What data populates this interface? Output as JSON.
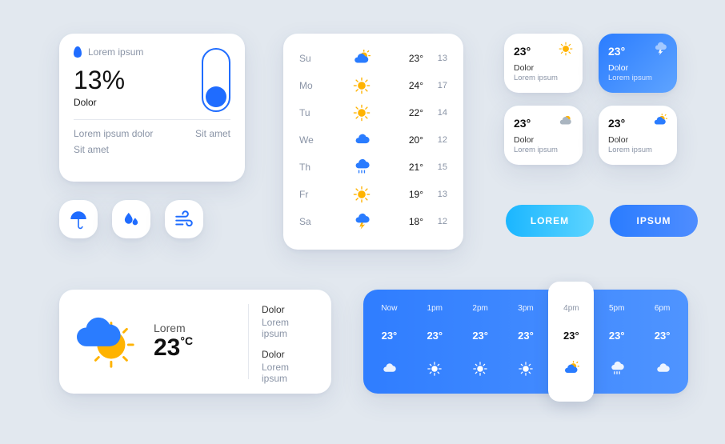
{
  "humidity": {
    "header": "Lorem ipsum",
    "value": "13%",
    "label": "Dolor",
    "line1_left": "Lorem ipsum dolor",
    "line1_right": "Sit amet",
    "line2": "Sit amet"
  },
  "tiles": [
    {
      "name": "umbrella"
    },
    {
      "name": "raindrops"
    },
    {
      "name": "wind"
    }
  ],
  "weekly": [
    {
      "day": "Su",
      "icon": "partly",
      "hi": "23°",
      "lo": "13"
    },
    {
      "day": "Mo",
      "icon": "sunny",
      "hi": "24°",
      "lo": "17"
    },
    {
      "day": "Tu",
      "icon": "sunny",
      "hi": "22°",
      "lo": "14"
    },
    {
      "day": "We",
      "icon": "cloudy",
      "hi": "20°",
      "lo": "12"
    },
    {
      "day": "Th",
      "icon": "rain",
      "hi": "21°",
      "lo": "15"
    },
    {
      "day": "Fr",
      "icon": "sunny",
      "hi": "19°",
      "lo": "13"
    },
    {
      "day": "Sa",
      "icon": "storm",
      "hi": "18°",
      "lo": "12"
    }
  ],
  "mini": [
    {
      "variant": "white",
      "temp": "23°",
      "icon": "sunny",
      "l1": "Dolor",
      "l2": "Lorem ipsum"
    },
    {
      "variant": "blue",
      "temp": "23°",
      "icon": "storm-white",
      "l1": "Dolor",
      "l2": "Lorem ipsum"
    },
    {
      "variant": "white",
      "temp": "23°",
      "icon": "partly-grey",
      "l1": "Dolor",
      "l2": "Lorem ipsum"
    },
    {
      "variant": "white",
      "temp": "23°",
      "icon": "partly",
      "l1": "Dolor",
      "l2": "Lorem ipsum"
    }
  ],
  "buttons": {
    "primary": "LOREM",
    "secondary": "IPSUM"
  },
  "current": {
    "label": "Lorem",
    "temp": "23",
    "unit": "°C",
    "k1": "Dolor",
    "v1": "Lorem ipsum",
    "k2": "Dolor",
    "v2": "Lorem ipsum"
  },
  "hourly": [
    {
      "label": "Now",
      "temp": "23°",
      "icon": "cloudg"
    },
    {
      "label": "1pm",
      "temp": "23°",
      "icon": "sunw"
    },
    {
      "label": "2pm",
      "temp": "23°",
      "icon": "sunw"
    },
    {
      "label": "3pm",
      "temp": "23°",
      "icon": "sunw"
    },
    {
      "label": "4pm",
      "temp": "23°",
      "icon": "partly",
      "selected": true
    },
    {
      "label": "5pm",
      "temp": "23°",
      "icon": "rainw"
    },
    {
      "label": "6pm",
      "temp": "23°",
      "icon": "cloudg"
    }
  ],
  "colors": {
    "accent": "#1f6cff",
    "sun": "#ffb300"
  }
}
